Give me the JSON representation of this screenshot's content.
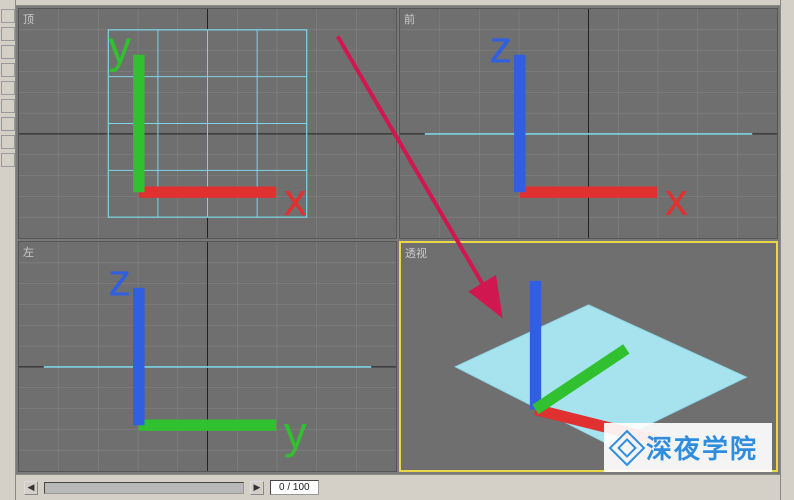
{
  "viewports": {
    "top_left": {
      "label": "顶"
    },
    "top_right": {
      "label": "前"
    },
    "bottom_left": {
      "label": "左"
    },
    "bottom_right": {
      "label": "透视",
      "active": true
    }
  },
  "timeline": {
    "frame_display": "0 / 100"
  },
  "watermark": {
    "text": "深夜学院"
  },
  "colors": {
    "plane_fill": "#a6e3ee",
    "plane_edge": "#7fd4e6",
    "grid_minor": "#858585",
    "grid_major": "#555555",
    "viewport_bg": "#6f6f6f",
    "active_border": "#e8d848",
    "arrow": "#d1174f"
  }
}
